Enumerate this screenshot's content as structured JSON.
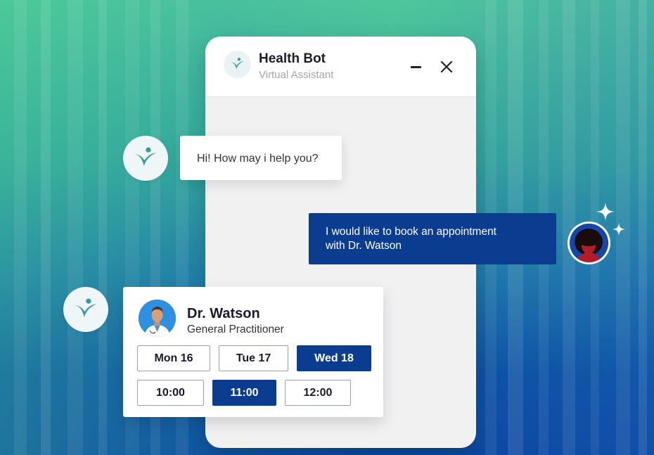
{
  "header": {
    "title": "Health Bot",
    "subtitle": "Virtual Assistant"
  },
  "icons": {
    "bot_logo": "heart-person-logo-icon",
    "minimize": "minimize-icon",
    "close": "close-icon",
    "sparkle": "sparkle-icon"
  },
  "messages": {
    "bot_greeting": "Hi! How may i help you?",
    "user_line1": "I would like to book an appointment",
    "user_line2": "with Dr. Watson"
  },
  "doctor": {
    "name": "Dr. Watson",
    "role": "General Practitioner"
  },
  "days": [
    {
      "label": "Mon 16",
      "selected": false
    },
    {
      "label": "Tue 17",
      "selected": false
    },
    {
      "label": "Wed 18",
      "selected": true
    }
  ],
  "times": [
    {
      "label": "10:00",
      "selected": false
    },
    {
      "label": "11:00",
      "selected": true
    },
    {
      "label": "12:00",
      "selected": false
    }
  ],
  "colors": {
    "primary": "#0a3d8f",
    "logo_teal": "#3f97a6",
    "bg_green": "#4fc79b",
    "bg_blue": "#0a46a0"
  }
}
